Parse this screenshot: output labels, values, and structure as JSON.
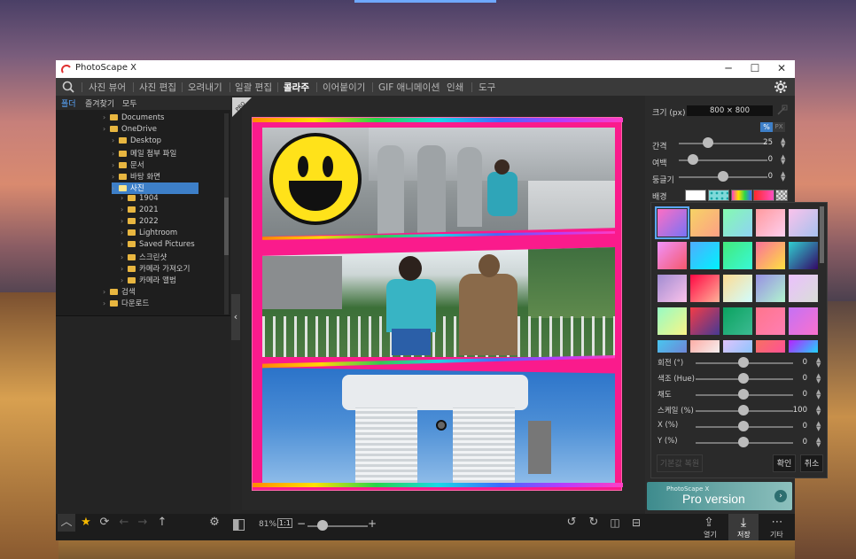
{
  "app": {
    "title": "PhotoScape X",
    "minimize": "─",
    "maximize": "☐",
    "close": "✕"
  },
  "menu": {
    "tabs": [
      "사진 뷰어",
      "사진 편집",
      "오려내기",
      "일괄 편집",
      "콜라주",
      "이어붙이기",
      "GIF 애니메이션",
      "인쇄",
      "도구"
    ],
    "active": "콜라주"
  },
  "leftpane": {
    "tabs": [
      "폴더",
      "즐겨찾기",
      "모두"
    ],
    "tree": [
      {
        "label": "Documents",
        "indent": 0
      },
      {
        "label": "OneDrive",
        "indent": 0
      },
      {
        "label": "Desktop",
        "indent": 1
      },
      {
        "label": "메일 첨부 파일",
        "indent": 1
      },
      {
        "label": "문서",
        "indent": 1
      },
      {
        "label": "바탕 화면",
        "indent": 1
      },
      {
        "label": "사진",
        "indent": 1,
        "selected": true
      },
      {
        "label": "1904",
        "indent": 2
      },
      {
        "label": "2021",
        "indent": 2
      },
      {
        "label": "2022",
        "indent": 2
      },
      {
        "label": "Lightroom",
        "indent": 2
      },
      {
        "label": "Saved Pictures",
        "indent": 2
      },
      {
        "label": "스크린샷",
        "indent": 2
      },
      {
        "label": "카메라 가져오기",
        "indent": 2
      },
      {
        "label": "카메라 앨범",
        "indent": 2
      },
      {
        "label": "검색",
        "indent": 0
      },
      {
        "label": "다운로드",
        "indent": 0
      }
    ]
  },
  "canvas": {
    "pro_badge": "PRO"
  },
  "rightpanel": {
    "size_label": "크기 (px)",
    "size_value": "800 × 800",
    "unit_percent": "%",
    "unit_px": "PX",
    "spacing_label": "간격",
    "spacing_value": "25",
    "spacing_level": 0.25,
    "margin_label": "여백",
    "margin_value": "0",
    "margin_level": 0,
    "round_label": "둥글기",
    "round_value": "0",
    "round_level": 0.5,
    "bg_label": "배경"
  },
  "popup": {
    "rows": [
      {
        "label": "회전 (°)",
        "value": "0"
      },
      {
        "label": "색조 (Hue)",
        "value": "0"
      },
      {
        "label": "채도",
        "value": "0"
      },
      {
        "label": "스케일 (%)",
        "value": "100"
      },
      {
        "label": "X (%)",
        "value": "0"
      },
      {
        "label": "Y (%)",
        "value": "0"
      }
    ],
    "default_btn": "기본값 복원",
    "ok_btn": "확인",
    "cancel_btn": "취소"
  },
  "bottombar": {
    "zoom": "81%",
    "ratio": "1:1",
    "zoom_level": 0.25,
    "open_label": "열기",
    "save_label": "저장",
    "more_label": "기타"
  },
  "pro_banner": {
    "small": "PhotoScape X",
    "big": "Pro version"
  }
}
